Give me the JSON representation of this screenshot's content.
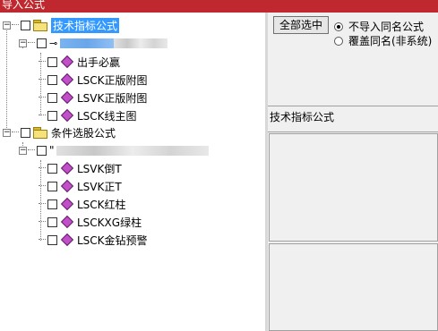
{
  "window": {
    "title": "导入公式"
  },
  "tree": {
    "root1": {
      "label": "技术指标公式"
    },
    "root1_child": {
      "items": [
        "出手必赢",
        "LSCK正版附图",
        "LSVK正版附图",
        "LSCK线主图"
      ]
    },
    "root2": {
      "label": "条件选股公式"
    },
    "root2_child": {
      "prefix": "\"",
      "items": [
        "LSVK倒T",
        "LSVK正T",
        "LSCK红柱",
        "LSCKXG绿柱",
        "LSCK金钻预警"
      ]
    }
  },
  "options": {
    "select_all_label": "全部选中",
    "radio_no_import": "不导入同名公式",
    "radio_overwrite": "覆盖同名(非系统)",
    "selected": "radio_no_import"
  },
  "info_label": "技术指标公式",
  "colors": {
    "titlebar": "#c0282f",
    "selection": "#3399ff",
    "formula_icon": "#c050c8"
  }
}
